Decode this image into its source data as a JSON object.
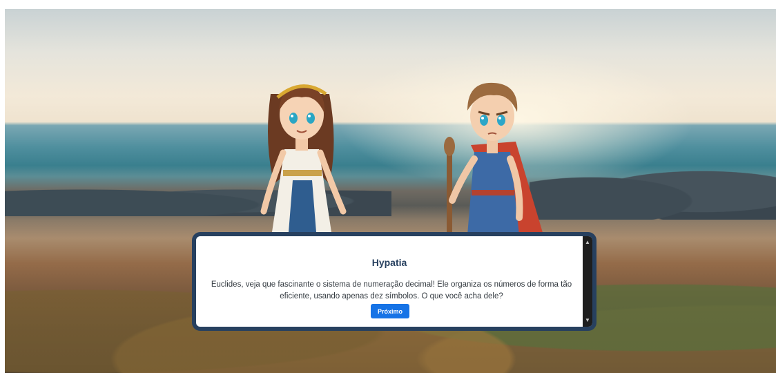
{
  "dialog": {
    "speaker": "Hypatia",
    "message": "Euclides, veja que fascinante o sistema de numeração decimal! Ele organiza os números de forma tão eficiente, usando apenas dez símbolos. O que você acha dele?",
    "next_label": "Próximo"
  },
  "scrollbar": {
    "up_icon": "▲",
    "down_icon": "▼"
  },
  "colors": {
    "dialog_border": "#27405f",
    "button": "#1673e6",
    "speaker_text": "#27405f"
  }
}
